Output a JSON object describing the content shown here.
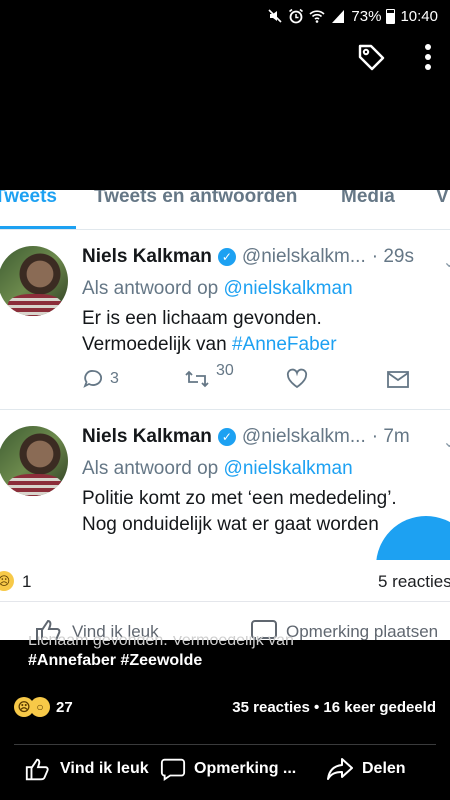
{
  "status_bar": {
    "battery": "73%",
    "time": "10:40"
  },
  "top_actions": {
    "tag_icon": "tag-icon",
    "menu_icon": "more-vertical-icon"
  },
  "twitter": {
    "tabs": [
      "Tweets",
      "Tweets en antwoorden",
      "Media",
      "V"
    ],
    "active_tab": 0,
    "tweets": [
      {
        "name": "Niels Kalkman",
        "handle": "@nielskalkm...",
        "time": "· 29s",
        "reply_prefix": "Als antwoord op",
        "reply_to": "@nielskalkman",
        "line1": "Er is een lichaam gevonden.",
        "line2_prefix": "Vermoedelijk van",
        "hashtag": "#AnneFaber",
        "replies": "3",
        "retweets": "30"
      },
      {
        "name": "Niels Kalkman",
        "handle": "@nielskalkm...",
        "time": "· 7m",
        "reply_prefix": "Als antwoord op",
        "reply_to": "@nielskalkman",
        "line1": "Politie komt zo met ‘een mededeling’.",
        "line2": "Nog onduidelijk wat er gaat worden"
      }
    ],
    "inner_reactions": "1",
    "inner_comments": "5 reacties",
    "inner_like": "Vind ik leuk",
    "inner_comment": "Opmerking plaatsen"
  },
  "post": {
    "caption_ghost": "Lichaam gevonden.  Vermoedelijk van",
    "hashtags": "#Annefaber  #Zeewolde",
    "reaction_count": "27",
    "stats": "35 reacties • 16 keer gedeeld",
    "like_label": "Vind ik leuk",
    "comment_label": "Opmerking ...",
    "share_label": "Delen"
  }
}
